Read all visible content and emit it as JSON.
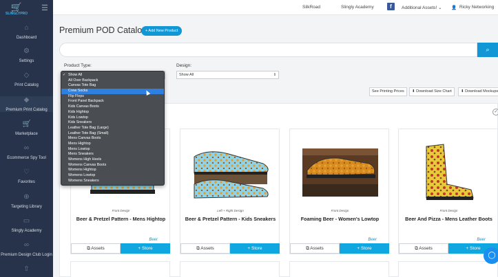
{
  "logo": {
    "text": "SLINGLYPRO"
  },
  "sidebar": {
    "items": [
      {
        "label": "Dashboard",
        "icon": "home-icon",
        "glyph": "⌂"
      },
      {
        "label": "Settings",
        "icon": "gear-icon",
        "glyph": "⚙"
      },
      {
        "label": "Print Catalog",
        "icon": "tag-icon",
        "glyph": "◇"
      },
      {
        "label": "Premium Print Catalog",
        "icon": "diamond-icon",
        "glyph": "◆"
      },
      {
        "label": "Marketplace",
        "icon": "cart-icon",
        "glyph": "🛒"
      },
      {
        "label": "Ecommerce Spy Tool",
        "icon": "link-icon",
        "glyph": "∞"
      },
      {
        "label": "Favorites",
        "icon": "heart-icon",
        "glyph": "♡"
      },
      {
        "label": "Targeting Library",
        "icon": "crosshair-icon",
        "glyph": "⊕"
      },
      {
        "label": "Slingly Academy",
        "icon": "chat-icon",
        "glyph": "▭"
      },
      {
        "label": "Premium Design Club Login",
        "icon": "link-icon",
        "glyph": "∞"
      },
      {
        "label": "",
        "icon": "upload-icon",
        "glyph": "⇧"
      }
    ]
  },
  "topbar": {
    "links": [
      "SilkRoad",
      "Slingly Academy",
      "Additional Assets!",
      "Ricky Networking"
    ],
    "caret": "⌄"
  },
  "page": {
    "title": "Premium POD Catalog",
    "add_button": "+ Add New Product"
  },
  "search": {
    "placeholder": "",
    "button_icon": "search-icon"
  },
  "filters": {
    "product_type_label": "Product Type:",
    "design_label": "Design:",
    "design_value": "Show All",
    "options": [
      "Show All",
      "All Over Backpack",
      "Canvas Tote Bag",
      "Crew Socks",
      "Flip Flops",
      "Front Panel Backpack",
      "Kids Canvas Boots",
      "Kids Hightop",
      "Kids Lowtop",
      "Kids Sneakers",
      "Leather Tote Bag (Large)",
      "Leather Tote Bag (Small)",
      "Mens Canvas Boots",
      "Mens Hightop",
      "Mens Lowtop",
      "Mens Sneakers",
      "Womens High Heels",
      "Womens Canvas Boots",
      "Womens Hightop",
      "Womens Lowtop",
      "Womens Sneakers"
    ],
    "checked_index": 0,
    "highlighted_index": 3
  },
  "actions": {
    "see_pricing": "See Printing Prices",
    "download_size_chart": "⬇ Download Size Chart",
    "download_mockups": "⬇ Download Mockups"
  },
  "products": [
    {
      "design": "Front Design",
      "name": "Beer & Pretzel Pattern - Mens Hightop",
      "tag": "Beer",
      "assets": "⧉ Assets",
      "store": "+ Store",
      "style": "hightop"
    },
    {
      "design": "Left + Right Design",
      "name": "Beer & Pretzel Pattern - Kids Sneakers",
      "tag": "",
      "assets": "⧉ Assets",
      "store": "+ Store",
      "style": "sneaker"
    },
    {
      "design": "Front Design",
      "name": "Foaming Beer - Women's Lowtop",
      "tag": "Beer",
      "assets": "⧉ Assets",
      "store": "+ Store",
      "style": "lowtop"
    },
    {
      "design": "Front Design",
      "name": "Beer And Pizza - Mens Leather Boots",
      "tag": "Beer",
      "assets": "⧉ Assets",
      "store": "+ Store",
      "style": "boot"
    }
  ],
  "colors": {
    "accent": "#1297d6",
    "sidebar": "#26334a",
    "store": "#10a6e0"
  }
}
